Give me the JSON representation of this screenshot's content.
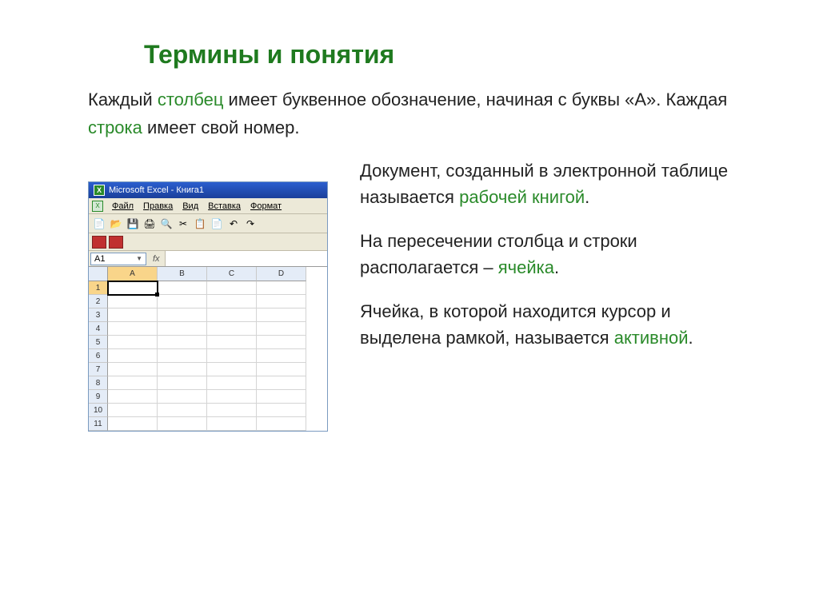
{
  "title": "Термины и понятия",
  "intro": {
    "t1": "Каждый ",
    "hl1": "столбец",
    "t2": " имеет буквенное обозначение, начиная с буквы «А». Каждая ",
    "hl2": "строка",
    "t3": " имеет свой номер."
  },
  "para1": {
    "t1": "Документ, созданный в электронной таблице называется ",
    "hl1": "рабочей книгой",
    "t2": "."
  },
  "para2": {
    "t1": "На пересечении столбца и строки располагается – ",
    "hl1": "ячейка",
    "t2": "."
  },
  "para3": {
    "t1": "Ячейка, в которой находится курсор и выделена рамкой, называется ",
    "hl1": "активной",
    "t2": "."
  },
  "excel": {
    "title": "Microsoft Excel - Книга1",
    "menus": [
      "Файл",
      "Правка",
      "Вид",
      "Вставка",
      "Формат"
    ],
    "namebox": "A1",
    "fx": "fx",
    "cols": [
      "A",
      "B",
      "C",
      "D"
    ],
    "rows": [
      "1",
      "2",
      "3",
      "4",
      "5",
      "6",
      "7",
      "8",
      "9",
      "10",
      "11"
    ]
  }
}
